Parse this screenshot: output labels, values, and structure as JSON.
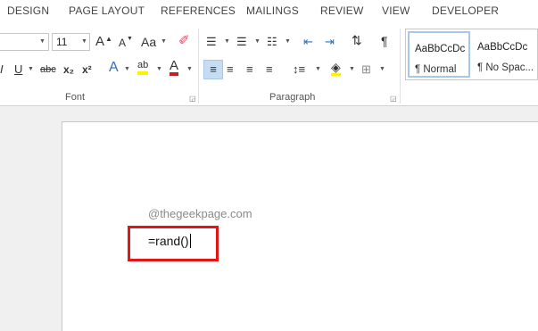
{
  "tabs": [
    "DESIGN",
    "PAGE LAYOUT",
    "REFERENCES",
    "MAILINGS",
    "REVIEW",
    "VIEW",
    "DEVELOPER"
  ],
  "font": {
    "size_value": "11",
    "group_label": "Font",
    "grow_label": "A",
    "shrink_label": "A",
    "change_case_label": "Aa",
    "italic_label": "I",
    "underline_label": "U",
    "strike_label": "abc",
    "subscript_label": "x₂",
    "superscript_label": "x²",
    "effects_label": "A",
    "highlight_label": "ab",
    "color_label": "A"
  },
  "paragraph": {
    "group_label": "Paragraph",
    "pilcrow": "¶"
  },
  "styles": [
    {
      "sample": "AaBbCcDc",
      "name": "¶ Normal"
    },
    {
      "sample": "AaBbCcDc",
      "name": "¶ No Spac..."
    }
  ],
  "document": {
    "watermark": "@thegeekpage.com",
    "typed_text": "=rand()"
  },
  "colors": {
    "highlight_box": "#e21616",
    "selected_style_border": "#a8c8ea",
    "active_align_bg": "#c5dcf3"
  }
}
